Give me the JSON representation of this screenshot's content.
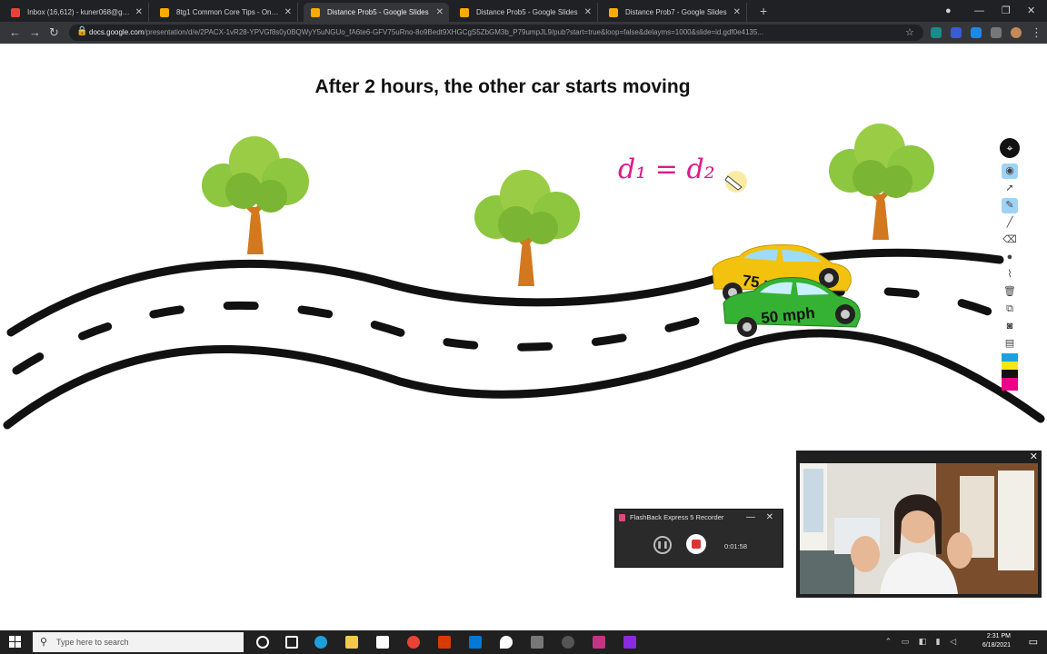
{
  "browser": {
    "tabs": [
      {
        "title": "Inbox (16,612) - kuner068@gm...",
        "favicon_color": "#ea4335",
        "active": false
      },
      {
        "title": "8tg1 Common Core Tips - One...",
        "favicon_color": "#f9ab00",
        "active": false
      },
      {
        "title": "Distance Prob5 - Google Slides",
        "favicon_color": "#f9ab00",
        "active": true
      },
      {
        "title": "Distance Prob5 - Google Slides",
        "favicon_color": "#f9ab00",
        "active": false
      },
      {
        "title": "Distance Prob7 - Google Slides",
        "favicon_color": "#f9ab00",
        "active": false
      }
    ],
    "new_tab_symbol": "+",
    "url_host": "docs.google.com",
    "url_path": "/presentation/d/e/2PACX-1vR28-YPVGf8s0y0BQWyY5uNGUo_fA6te6-GFV75uRno-8o9Bedt9XHGCgS5ZbGM3b_P79umpJL9/pub?start=true&loop=false&delayms=1000&slide=id.gdf0e4135..."
  },
  "slide": {
    "title": "After 2 hours, the other car starts moving",
    "annotation": "d₁ = d₂",
    "yellow_car_label": "75 mph",
    "green_car_label": "50 mph",
    "colors": {
      "annotation": "#e0198a",
      "yellow_car": "#f2c20f",
      "green_car": "#35b233",
      "foliage": "#8dc63f",
      "trunk": "#d2781e"
    }
  },
  "pen_toolbar": {
    "pin_icon": "map-pin-icon",
    "tools": [
      "eye",
      "cursor",
      "pen",
      "line",
      "eraser",
      "dot",
      "highlighter",
      "trash",
      "screenshot",
      "camera",
      "clipboard"
    ],
    "swatches": [
      "#1ba1e2",
      "#f5e616",
      "#111111",
      "#ec008c"
    ]
  },
  "recorder": {
    "title": "FlashBack Express 5 Recorder",
    "time": "0:01:58"
  },
  "taskbar": {
    "search_placeholder": "Type here to search",
    "time": "2:31 PM",
    "date": "6/18/2021"
  }
}
